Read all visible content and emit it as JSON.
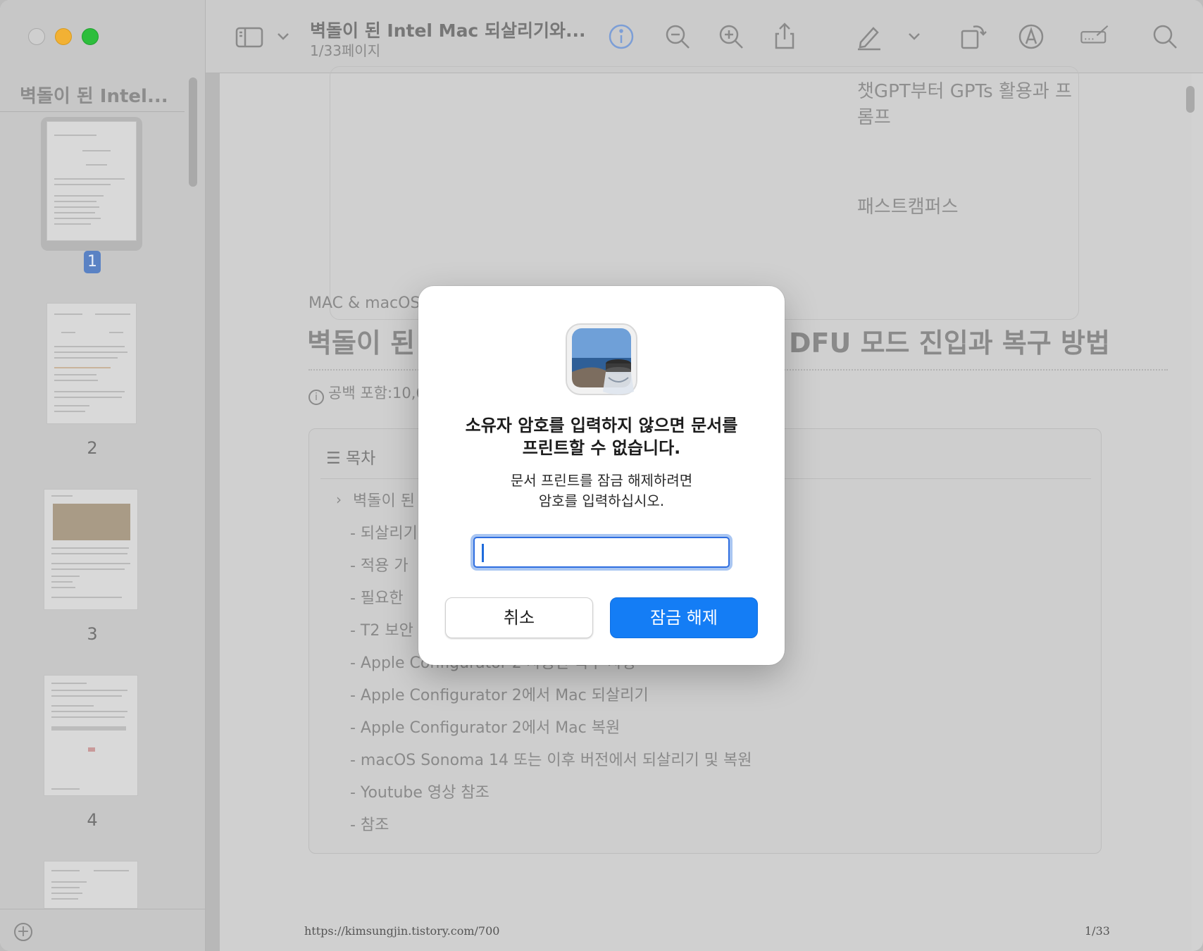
{
  "window": {
    "sidebar_title": "벽돌이 된 Intel...",
    "doc_title": "벽돌이 된 Intel Mac 되살리기와...",
    "page_indicator": "1/33페이지"
  },
  "toolbar": {
    "icons": [
      "sidebar-icon",
      "chevron-down-icon",
      "info-icon",
      "zoom-out-icon",
      "zoom-in-icon",
      "share-icon",
      "markup-pen-icon",
      "chevron-down-icon",
      "rotate-icon",
      "annotate-icon",
      "form-fill-icon",
      "search-icon"
    ]
  },
  "sidebar": {
    "pages": [
      {
        "label": "1",
        "selected": true
      },
      {
        "label": "2",
        "selected": false
      },
      {
        "label": "3",
        "selected": false
      },
      {
        "label": "4",
        "selected": false
      }
    ]
  },
  "document": {
    "promo_line1": "챗GPT부터 GPTs 활용과 프롬프",
    "promo_line2": "패스트캠퍼스",
    "category": "MAC & macOS",
    "title_left": "벽돌이 된",
    "title_right": "DFU 모드 진입과 복구 방법",
    "meta": "공백 포함:10,6",
    "toc_heading": "목차",
    "toc_items": [
      "벽돌이 된",
      "- 되살리기",
      "- 적용 가",
      "- 필요한",
      "- T2 보안",
      "- Apple Configurator 2 사용한 복구 사항",
      "- Apple Configurator 2에서 Mac 되살리기",
      "- Apple Configurator 2에서 Mac 복원",
      "- macOS Sonoma 14 또는 이후 버전에서 되살리기 및 복원",
      "- Youtube 영상 참조",
      "- 참조"
    ],
    "footer_url": "https://kimsungjin.tistory.com/700",
    "footer_page": "1/33"
  },
  "dialog": {
    "title_line1": "소유자 암호를 입력하지 않으면 문서를",
    "title_line2": "프린트할 수 없습니다.",
    "message_line1": "문서 프린트를 잠금 해제하려면",
    "message_line2": "암호를 입력하십시오.",
    "password_value": "",
    "cancel_label": "취소",
    "unlock_label": "잠금 해제"
  },
  "colors": {
    "accent": "#147df5",
    "focus_ring": "#a9c6f2",
    "traffic_close": "#cfcfcf",
    "traffic_min": "#f2b134",
    "traffic_max": "#2dbe3c"
  }
}
